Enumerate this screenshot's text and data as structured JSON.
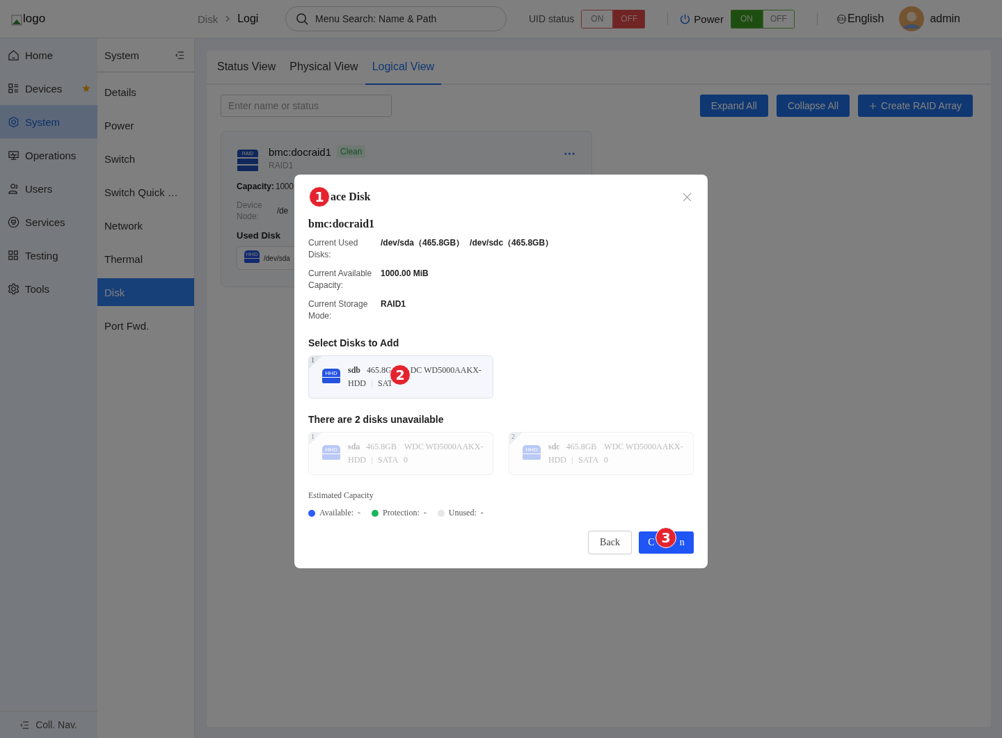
{
  "header": {
    "logo_alt": "logo",
    "breadcrumb": [
      "Disk",
      "Logi"
    ],
    "search": {
      "placeholder": "Menu Search: Name & Path"
    },
    "uid_status": {
      "label": "UID status",
      "options": [
        {
          "label": "ON",
          "selected": false
        },
        {
          "label": "OFF",
          "selected": true
        }
      ]
    },
    "power": {
      "label": "Power",
      "options": [
        {
          "label": "ON",
          "selected": true
        },
        {
          "label": "OFF",
          "selected": false
        }
      ]
    },
    "language": {
      "badge": "EN",
      "label": "English"
    },
    "user": "admin"
  },
  "nav": {
    "items": [
      {
        "label": "Home",
        "selected": false,
        "starred": false
      },
      {
        "label": "Devices",
        "selected": false,
        "starred": true
      },
      {
        "label": "System",
        "selected": true,
        "starred": false
      },
      {
        "label": "Operations",
        "selected": false,
        "starred": false
      },
      {
        "label": "Users",
        "selected": false,
        "starred": false
      },
      {
        "label": "Services",
        "selected": false,
        "starred": false
      },
      {
        "label": "Testing",
        "selected": false,
        "starred": false
      },
      {
        "label": "Tools",
        "selected": false,
        "starred": false
      }
    ],
    "collapse": "Coll. Nav."
  },
  "subnav": {
    "title": "System",
    "items": [
      {
        "label": "Details",
        "selected": false
      },
      {
        "label": "Power",
        "selected": false
      },
      {
        "label": "Switch",
        "selected": false
      },
      {
        "label": "Switch Quick …",
        "selected": false
      },
      {
        "label": "Network",
        "selected": false
      },
      {
        "label": "Thermal",
        "selected": false
      },
      {
        "label": "Disk",
        "selected": true
      },
      {
        "label": "Port Fwd.",
        "selected": false
      }
    ]
  },
  "tabs": [
    {
      "label": "Status View",
      "selected": false
    },
    {
      "label": "Physical View",
      "selected": false
    },
    {
      "label": "Logical View",
      "selected": true
    }
  ],
  "filter": {
    "placeholder": "Enter name or status"
  },
  "actions": [
    {
      "label": "Expand All",
      "kind": "plain"
    },
    {
      "label": "Collapse All",
      "kind": "plain"
    },
    {
      "label": "Create RAID Array",
      "kind": "create"
    }
  ],
  "raid_card": {
    "icon_text": "RAID",
    "name": "bmc:docraid1",
    "status": "Clean",
    "level": "RAID1",
    "capacity_label": "Capacity:",
    "capacity_value": "1000",
    "node_label": "Device Node:",
    "node_value": "/de",
    "used_label": "Used Disk",
    "used_disk": {
      "icon_text": "HHD",
      "name": "/dev/sda"
    }
  },
  "dialog": {
    "title": "ace Disk",
    "array_name": "bmc:docraid1",
    "info": [
      {
        "label": "Current Used Disks:",
        "values": [
          "/dev/sda（465.8GB）",
          "/dev/sdc（465.8GB）"
        ]
      },
      {
        "label": "Current Available Capacity:",
        "values": [
          "1000.00 MiB"
        ]
      },
      {
        "label": "Current Storage Mode:",
        "values": [
          "RAID1"
        ]
      }
    ],
    "select_title": "Select Disks to Add",
    "available": [
      {
        "index": "1",
        "icon_text": "HHD",
        "name": "sdb",
        "size": "465.8G",
        "model": "DC WD5000AAKX-",
        "type": "HDD",
        "bus": "SAT",
        "disabled": false
      }
    ],
    "unavailable_title": "There are 2 disks unavailable",
    "unavailable": [
      {
        "index": "1",
        "icon_text": "HHD",
        "name": "sda",
        "size": "465.8GB",
        "model": "WDC WD5000AAKX-",
        "type": "HDD",
        "bus": "SATA",
        "slot": "0",
        "disabled": true
      },
      {
        "index": "2",
        "icon_text": "HHD",
        "name": "sdc",
        "size": "465.8GB",
        "model": "WDC WD5000AAKX-",
        "type": "HDD",
        "bus": "SATA",
        "slot": "0",
        "disabled": true
      }
    ],
    "estimate_title": "Estimated Capacity",
    "legend": [
      {
        "label": "Available:",
        "value": "-",
        "color": "#2b5cff"
      },
      {
        "label": "Protection:",
        "value": "-",
        "color": "#1bb55c"
      },
      {
        "label": "Unused:",
        "value": "-",
        "color": "#e6e6e6"
      }
    ],
    "back": "Back",
    "confirm_start": "C",
    "confirm_end": "n"
  },
  "annotations": [
    {
      "number": "1"
    },
    {
      "number": "2"
    },
    {
      "number": "3"
    }
  ]
}
